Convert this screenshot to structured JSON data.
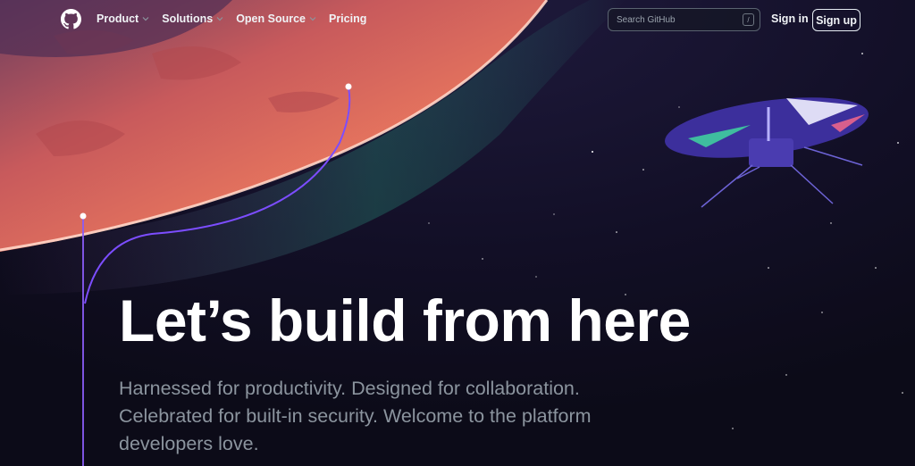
{
  "nav": {
    "logo_icon": "github-mark-icon",
    "items": [
      {
        "label": "Product",
        "has_dropdown": true
      },
      {
        "label": "Solutions",
        "has_dropdown": true
      },
      {
        "label": "Open Source",
        "has_dropdown": true
      },
      {
        "label": "Pricing",
        "has_dropdown": false
      }
    ],
    "search": {
      "placeholder": "Search GitHub",
      "shortcut": "/"
    },
    "signin_label": "Sign in",
    "signup_label": "Sign up"
  },
  "hero": {
    "headline": "Let’s build from here",
    "subhead": "Harnessed for productivity. Designed for collaboration. Celebrated for built-in security. Welcome to the platform developers love."
  },
  "colors": {
    "background": "#0d1117",
    "planet": "#e8715a",
    "atmosphere": "#2ea38a",
    "trail": "#7c4dff",
    "text_muted": "#8b949e"
  }
}
